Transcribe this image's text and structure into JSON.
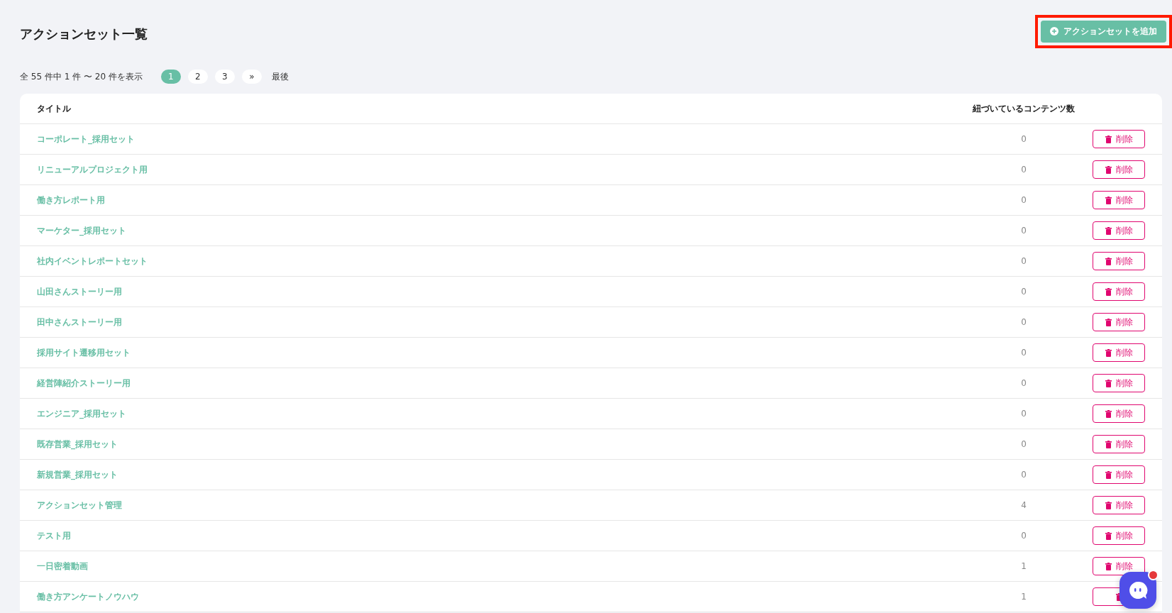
{
  "page": {
    "title": "アクションセット一覧"
  },
  "add_button": {
    "label": "アクションセットを追加",
    "highlighted": true
  },
  "pagination": {
    "summary": "全 55 件中 1 件 〜 20 件を表示",
    "pages": [
      {
        "label": "1",
        "selected": true
      },
      {
        "label": "2",
        "selected": false
      },
      {
        "label": "3",
        "selected": false
      },
      {
        "label": "»",
        "selected": false
      }
    ],
    "last": "最後"
  },
  "table": {
    "columns": [
      "タイトル",
      "紐づいているコンテンツ数"
    ],
    "rows": [
      {
        "title": "コーポレート_採用セット",
        "count": "0",
        "action": "削除"
      },
      {
        "title": "リニューアルプロジェクト用",
        "count": "0",
        "action": "削除"
      },
      {
        "title": "働き方レポート用",
        "count": "0",
        "action": "削除"
      },
      {
        "title": "マーケター_採用セット",
        "count": "0",
        "action": "削除"
      },
      {
        "title": "社内イベントレポートセット",
        "count": "0",
        "action": "削除"
      },
      {
        "title": "山田さんストーリー用",
        "count": "0",
        "action": "削除"
      },
      {
        "title": "田中さんストーリー用",
        "count": "0",
        "action": "削除"
      },
      {
        "title": "採用サイト遷移用セット",
        "count": "0",
        "action": "削除"
      },
      {
        "title": "経営陣紹介ストーリー用",
        "count": "0",
        "action": "削除"
      },
      {
        "title": "エンジニア_採用セット",
        "count": "0",
        "action": "削除"
      },
      {
        "title": "既存営業_採用セット",
        "count": "0",
        "action": "削除"
      },
      {
        "title": "新規営業_採用セット",
        "count": "0",
        "action": "削除"
      },
      {
        "title": "アクションセット管理",
        "count": "4",
        "action": "削除"
      },
      {
        "title": "テスト用",
        "count": "0",
        "action": "削除"
      },
      {
        "title": "一日密着動画",
        "count": "1",
        "action": "削除"
      },
      {
        "title": "働き方アンケートノウハウ",
        "count": "1"
      }
    ]
  },
  "chat_widget": {
    "unread": true
  }
}
